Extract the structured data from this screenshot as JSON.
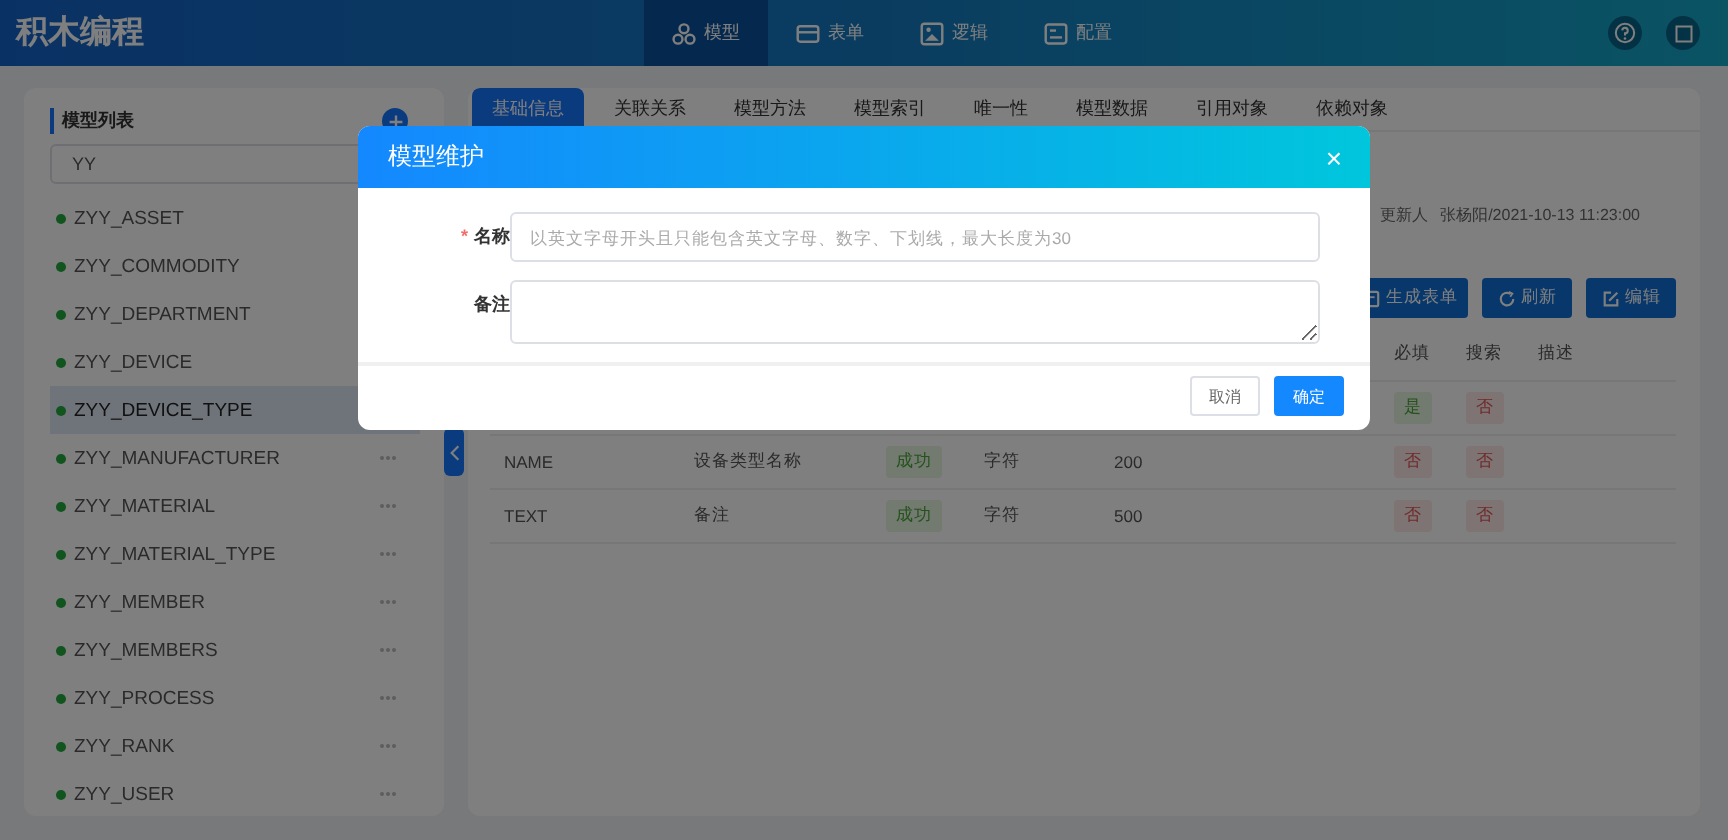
{
  "app_title": "积木编程",
  "nav": [
    {
      "label": "模型",
      "selected": true
    },
    {
      "label": "表单",
      "selected": false
    },
    {
      "label": "逻辑",
      "selected": false
    },
    {
      "label": "配置",
      "selected": false
    }
  ],
  "sidebar": {
    "title": "模型列表",
    "search_value": "YY",
    "items": [
      {
        "label": "ZYY_ASSET",
        "selected": false
      },
      {
        "label": "ZYY_COMMODITY",
        "selected": false
      },
      {
        "label": "ZYY_DEPARTMENT",
        "selected": false
      },
      {
        "label": "ZYY_DEVICE",
        "selected": false
      },
      {
        "label": "ZYY_DEVICE_TYPE",
        "selected": true
      },
      {
        "label": "ZYY_MANUFACTURER",
        "selected": false
      },
      {
        "label": "ZYY_MATERIAL",
        "selected": false
      },
      {
        "label": "ZYY_MATERIAL_TYPE",
        "selected": false
      },
      {
        "label": "ZYY_MEMBER",
        "selected": false
      },
      {
        "label": "ZYY_MEMBERS",
        "selected": false
      },
      {
        "label": "ZYY_PROCESS",
        "selected": false
      },
      {
        "label": "ZYY_RANK",
        "selected": false
      },
      {
        "label": "ZYY_USER",
        "selected": false
      }
    ]
  },
  "tabs": [
    {
      "label": "基础信息",
      "selected": true
    },
    {
      "label": "关联关系",
      "selected": false
    },
    {
      "label": "模型方法",
      "selected": false
    },
    {
      "label": "模型索引",
      "selected": false
    },
    {
      "label": "唯一性",
      "selected": false
    },
    {
      "label": "模型数据",
      "selected": false
    },
    {
      "label": "引用对象",
      "selected": false
    },
    {
      "label": "依赖对象",
      "selected": false
    }
  ],
  "info": {
    "label": "更新人",
    "value": "张杨阳/2021-10-13 11:23:00"
  },
  "actions": [
    {
      "label": "生成表单"
    },
    {
      "label": "刷新"
    },
    {
      "label": "编辑"
    }
  ],
  "table": {
    "columns": [
      "必填",
      "搜索",
      "描述"
    ],
    "rows": [
      {
        "required": {
          "text": "是",
          "positive": true
        },
        "search": {
          "text": "否",
          "positive": false
        }
      },
      {
        "name": "NAME",
        "label": "设备类型名称",
        "status": "成功",
        "type": "字符",
        "length": "200",
        "required": {
          "text": "否",
          "positive": false
        },
        "search": {
          "text": "否",
          "positive": false
        }
      },
      {
        "name": "TEXT",
        "label": "备注",
        "status": "成功",
        "type": "字符",
        "length": "500",
        "required": {
          "text": "否",
          "positive": false
        },
        "search": {
          "text": "否",
          "positive": false
        }
      }
    ]
  },
  "dialog": {
    "title": "模型维护",
    "close": "×",
    "fields": [
      {
        "label": "名称",
        "required_mark": "*",
        "kind": "input",
        "placeholder": "以英文字母开头且只能包含英文字母、数字、下划线，最大长度为30"
      },
      {
        "label": "备注",
        "kind": "textarea"
      }
    ],
    "buttons": [
      {
        "label": "取消",
        "primary": false
      },
      {
        "label": "确定",
        "primary": true
      }
    ]
  }
}
